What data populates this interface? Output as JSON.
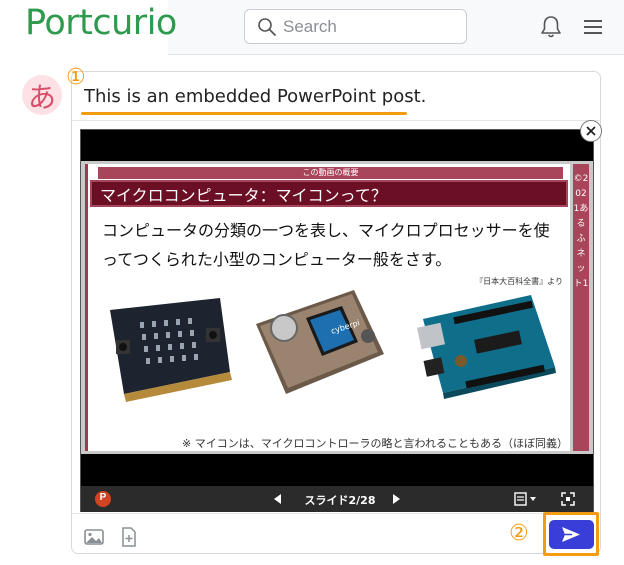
{
  "header": {
    "logo_text": "Portcurio",
    "search_placeholder": "Search"
  },
  "avatar": {
    "char": "あ"
  },
  "post": {
    "text": "This is an embedded PowerPoint post.",
    "marker_1": "①",
    "marker_2": "②"
  },
  "slide": {
    "kicker": "この動画の概要",
    "heading": "マイクロコンピュータ：マイコンって？",
    "body": "コンピュータの分類の一つを表し、マイクロプロセッサーを使ってつくられた小型のコンピューター般をさす。",
    "citation": "『日本大百科全書』より",
    "note": "※ マイコンは、マイクロコントローラの略と言われることもある（ほぼ同義）",
    "side_text": "©2021あるふネット1",
    "device_label": "cyberpi"
  },
  "viewer": {
    "counter": "スライド2/28",
    "app_icon_letter": "P"
  },
  "colors": {
    "accent": "#f39c12",
    "brand": "#2e9a4e",
    "send": "#3a3ed9",
    "slide_maroon": "#6b0f25"
  }
}
